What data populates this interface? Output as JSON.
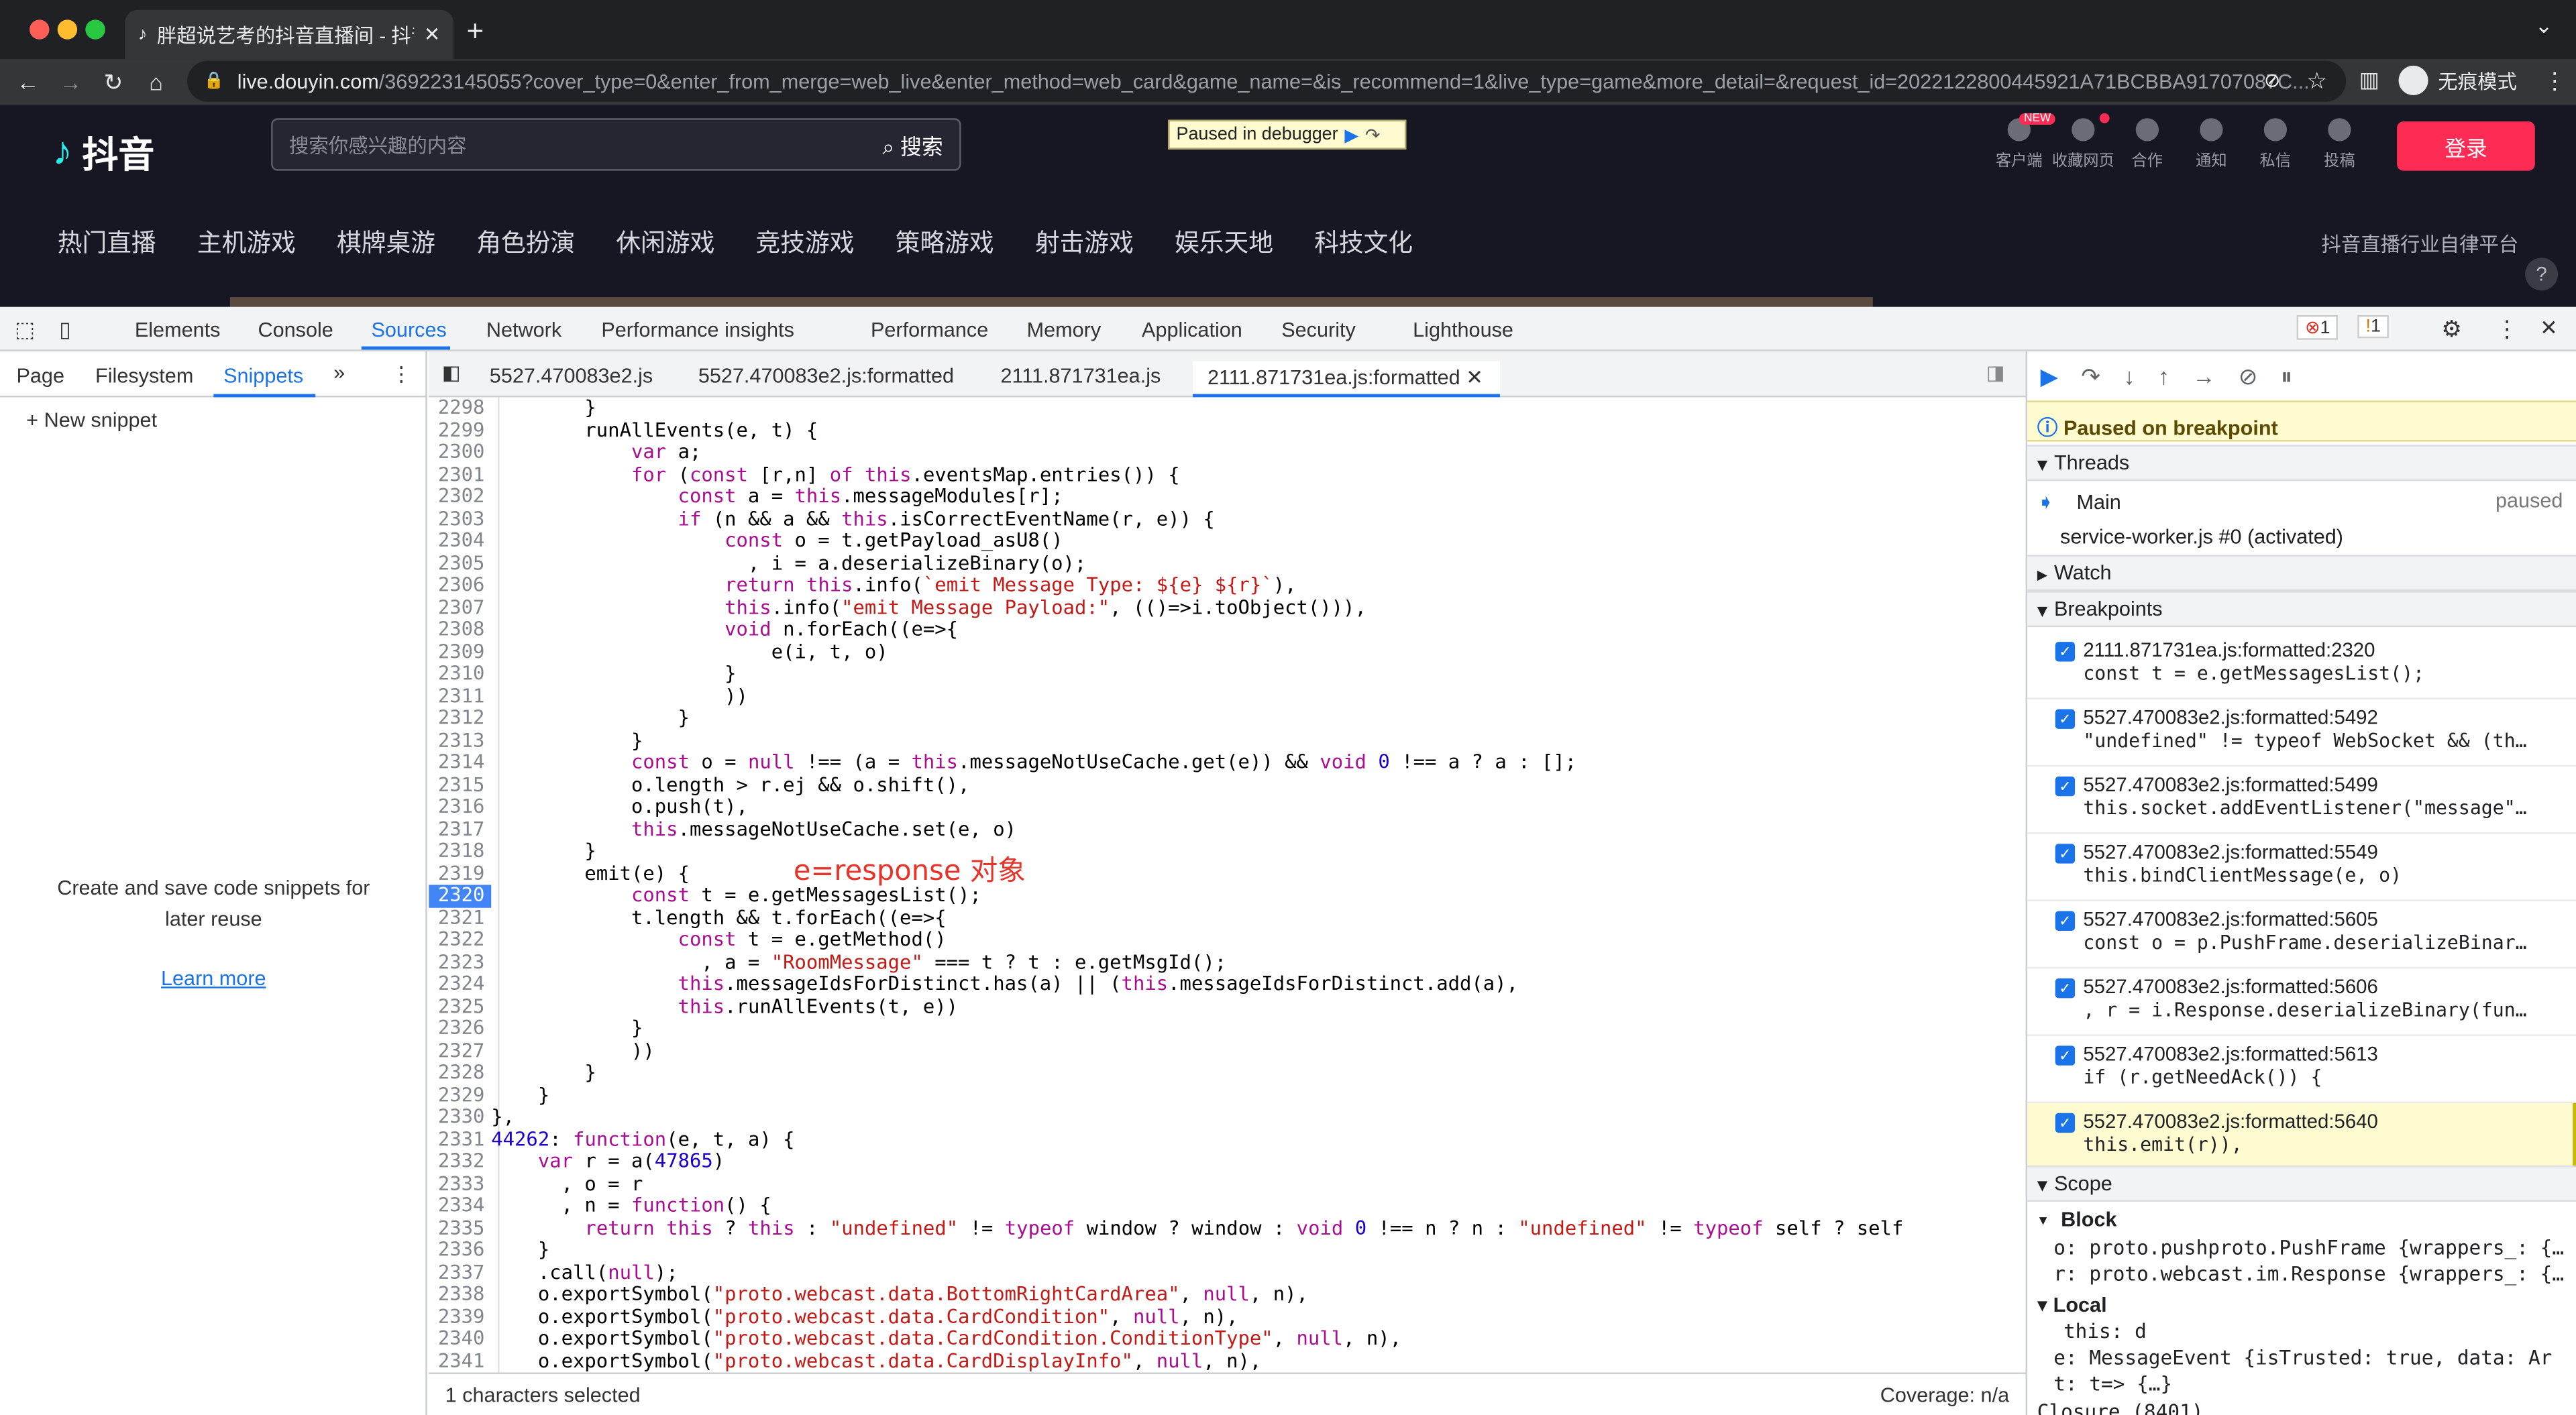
{
  "browser": {
    "tab_title": "胖超说艺考的抖音直播间 - 抖音直",
    "url_host": "live.douyin.com",
    "url_rest": "/369223145055?cover_type=0&enter_from_merge=web_live&enter_method=web_card&game_name=&is_recommend=1&live_type=game&more_detail=&request_id=2022122800445921A71BCBBA91707087C...",
    "incognito": "无痕模式"
  },
  "site": {
    "logo": "抖音",
    "search_placeholder": "搜索你感兴趣的内容",
    "search_button": "搜索",
    "paused_banner": "Paused in debugger",
    "header_icons": [
      "客户端",
      "收藏网页",
      "合作",
      "通知",
      "私信",
      "投稿"
    ],
    "new_badge": "NEW",
    "login": "登录",
    "categories": [
      "热门直播",
      "主机游戏",
      "棋牌桌游",
      "角色扮演",
      "休闲游戏",
      "竞技游戏",
      "策略游戏",
      "射击游戏",
      "娱乐天地",
      "科技文化"
    ],
    "platform_link": "抖音直播行业自律平台"
  },
  "devtools": {
    "tabs": [
      "Elements",
      "Console",
      "Sources",
      "Network",
      "Performance insights",
      "Performance",
      "Memory",
      "Application",
      "Security",
      "Lighthouse"
    ],
    "error_count": "1",
    "warning_count": "1",
    "nav_tabs": [
      "Page",
      "Filesystem",
      "Snippets"
    ],
    "new_snippet": "New snippet",
    "snippet_empty": "Create and save code snippets for later reuse",
    "learn_more": "Learn more",
    "editor_tabs": [
      "5527.470083e2.js",
      "5527.470083e2.js:formatted",
      "2111.871731ea.js",
      "2111.871731ea.js:formatted"
    ],
    "status_left": "1 characters selected",
    "status_right": "Coverage: n/a",
    "annotation": "e=response 对象",
    "code": [
      [
        "2298",
        "        }"
      ],
      [
        "2299",
        "        runAllEvents(e, t) {"
      ],
      [
        "2300",
        "            var a;"
      ],
      [
        "2301",
        "            for (const [r,n] of this.eventsMap.entries()) {"
      ],
      [
        "2302",
        "                const a = this.messageModules[r];"
      ],
      [
        "2303",
        "                if (n && a && this.isCorrectEventName(r, e)) {"
      ],
      [
        "2304",
        "                    const o = t.getPayload_asU8()"
      ],
      [
        "2305",
        "                      , i = a.deserializeBinary(o);"
      ],
      [
        "2306",
        "                    return this.info(`emit Message Type: ${e} ${r}`),"
      ],
      [
        "2307",
        "                    this.info(\"emit Message Payload:\", (()=>i.toObject())),"
      ],
      [
        "2308",
        "                    void n.forEach((e=>{"
      ],
      [
        "2309",
        "                        e(i, t, o)"
      ],
      [
        "2310",
        "                    }"
      ],
      [
        "2311",
        "                    ))"
      ],
      [
        "2312",
        "                }"
      ],
      [
        "2313",
        "            }"
      ],
      [
        "2314",
        "            const o = null !== (a = this.messageNotUseCache.get(e)) && void 0 !== a ? a : [];"
      ],
      [
        "2315",
        "            o.length > r.ej && o.shift(),"
      ],
      [
        "2316",
        "            o.push(t),"
      ],
      [
        "2317",
        "            this.messageNotUseCache.set(e, o)"
      ],
      [
        "2318",
        "        }"
      ],
      [
        "2319",
        "        emit(e) {"
      ],
      [
        "2320",
        "            const t = e.getMessagesList();"
      ],
      [
        "2321",
        "            t.length && t.forEach((e=>{"
      ],
      [
        "2322",
        "                const t = e.getMethod()"
      ],
      [
        "2323",
        "                  , a = \"RoomMessage\" === t ? t : e.getMsgId();"
      ],
      [
        "2324",
        "                this.messageIdsForDistinct.has(a) || (this.messageIdsForDistinct.add(a),"
      ],
      [
        "2325",
        "                this.runAllEvents(t, e))"
      ],
      [
        "2326",
        "            }"
      ],
      [
        "2327",
        "            ))"
      ],
      [
        "2328",
        "        }"
      ],
      [
        "2329",
        "    }"
      ],
      [
        "2330",
        "},"
      ],
      [
        "2331",
        "44262: function(e, t, a) {"
      ],
      [
        "2332",
        "    var r = a(47865)"
      ],
      [
        "2333",
        "      , o = r"
      ],
      [
        "2334",
        "      , n = function() {"
      ],
      [
        "2335",
        "        return this ? this : \"undefined\" != typeof window ? window : void 0 !== n ? n : \"undefined\" != typeof self ? self"
      ],
      [
        "2336",
        "    }"
      ],
      [
        "2337",
        "    .call(null);"
      ],
      [
        "2338",
        "    o.exportSymbol(\"proto.webcast.data.BottomRightCardArea\", null, n),"
      ],
      [
        "2339",
        "    o.exportSymbol(\"proto.webcast.data.CardCondition\", null, n),"
      ],
      [
        "2340",
        "    o.exportSymbol(\"proto.webcast.data.CardCondition.ConditionType\", null, n),"
      ],
      [
        "2341",
        "    o.exportSymbol(\"proto.webcast.data.CardDisplayInfo\", null, n),"
      ]
    ],
    "paused_msg": "Paused on breakpoint",
    "threads_label": "Threads",
    "thread_main": "Main",
    "thread_main_state": "paused",
    "thread_sw": "service-worker.js #0 (activated)",
    "watch_label": "Watch",
    "breakpoints_label": "Breakpoints",
    "breakpoints": [
      {
        "loc": "2111.871731ea.js:formatted:2320",
        "code": "const t = e.getMessagesList();"
      },
      {
        "loc": "5527.470083e2.js:formatted:5492",
        "code": "\"undefined\" != typeof WebSocket && (th…"
      },
      {
        "loc": "5527.470083e2.js:formatted:5499",
        "code": "this.socket.addEventListener(\"message\"…"
      },
      {
        "loc": "5527.470083e2.js:formatted:5549",
        "code": "this.bindClientMessage(e, o)"
      },
      {
        "loc": "5527.470083e2.js:formatted:5605",
        "code": "const o = p.PushFrame.deserializeBinar…"
      },
      {
        "loc": "5527.470083e2.js:formatted:5606",
        "code": ", r = i.Response.deserializeBinary(fun…"
      },
      {
        "loc": "5527.470083e2.js:formatted:5613",
        "code": "if (r.getNeedAck()) {"
      },
      {
        "loc": "5527.470083e2.js:formatted:5640",
        "code": "this.emit(r)),"
      }
    ],
    "scope_label": "Scope",
    "block_label": "Block",
    "scope_block": [
      "o: proto.pushproto.PushFrame {wrappers_: {…",
      "r: proto.webcast.im.Response {wrappers_: {…"
    ],
    "local_label": "Local",
    "scope_local": [
      "this: d",
      "e: MessageEvent {isTrusted: true, data: Ar",
      "t: t=> {…}"
    ],
    "closure": "Closure (8401)"
  },
  "colors": {
    "accent": "#1a73e8",
    "login": "#fe2c55",
    "paused_bg": "#fffbd0"
  }
}
